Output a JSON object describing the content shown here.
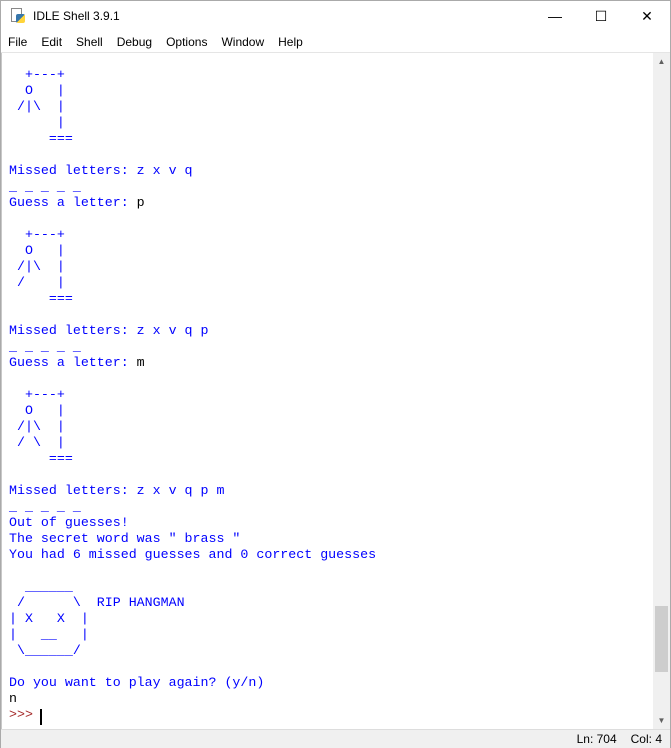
{
  "window": {
    "title": "IDLE Shell 3.9.1",
    "minimize": "—",
    "maximize": "☐",
    "close": "✕"
  },
  "menu": [
    "File",
    "Edit",
    "Shell",
    "Debug",
    "Options",
    "Window",
    "Help"
  ],
  "lines": [
    {
      "t": "  +---+",
      "k": "out"
    },
    {
      "t": "  O   |",
      "k": "out"
    },
    {
      "t": " /|\\  |",
      "k": "out"
    },
    {
      "t": "      |",
      "k": "out"
    },
    {
      "t": "     ===",
      "k": "out"
    },
    {
      "t": "",
      "k": "out"
    },
    {
      "t": "Missed letters: z x v q",
      "k": "out"
    },
    {
      "t": "_ _ _ _ _",
      "k": "out"
    },
    {
      "t": "Guess a letter: ",
      "k": "out",
      "in": "p"
    },
    {
      "t": "",
      "k": "out"
    },
    {
      "t": "  +---+",
      "k": "out"
    },
    {
      "t": "  O   |",
      "k": "out"
    },
    {
      "t": " /|\\  |",
      "k": "out"
    },
    {
      "t": " /    |",
      "k": "out"
    },
    {
      "t": "     ===",
      "k": "out"
    },
    {
      "t": "",
      "k": "out"
    },
    {
      "t": "Missed letters: z x v q p",
      "k": "out"
    },
    {
      "t": "_ _ _ _ _",
      "k": "out"
    },
    {
      "t": "Guess a letter: ",
      "k": "out",
      "in": "m"
    },
    {
      "t": "",
      "k": "out"
    },
    {
      "t": "  +---+",
      "k": "out"
    },
    {
      "t": "  O   |",
      "k": "out"
    },
    {
      "t": " /|\\  |",
      "k": "out"
    },
    {
      "t": " / \\  |",
      "k": "out"
    },
    {
      "t": "     ===",
      "k": "out"
    },
    {
      "t": "",
      "k": "out"
    },
    {
      "t": "Missed letters: z x v q p m",
      "k": "out"
    },
    {
      "t": "_ _ _ _ _",
      "k": "out"
    },
    {
      "t": "Out of guesses!",
      "k": "out"
    },
    {
      "t": "The secret word was \" brass \"",
      "k": "out"
    },
    {
      "t": "You had 6 missed guesses and 0 correct guesses",
      "k": "out"
    },
    {
      "t": "",
      "k": "out"
    },
    {
      "t": "  ______",
      "k": "out"
    },
    {
      "t": " /      \\  RIP HANGMAN",
      "k": "out"
    },
    {
      "t": "| X   X  |",
      "k": "out"
    },
    {
      "t": "|   __   |",
      "k": "out"
    },
    {
      "t": " \\______/",
      "k": "out"
    },
    {
      "t": "",
      "k": "out"
    },
    {
      "t": "Do you want to play again? (y/n)",
      "k": "out"
    },
    {
      "t": "n",
      "k": "stdin"
    },
    {
      "t": ">>> ",
      "k": "prompt"
    }
  ],
  "status": {
    "ln": "Ln: 704",
    "col": "Col: 4"
  },
  "scroll": {
    "position_fraction": 0.93
  }
}
